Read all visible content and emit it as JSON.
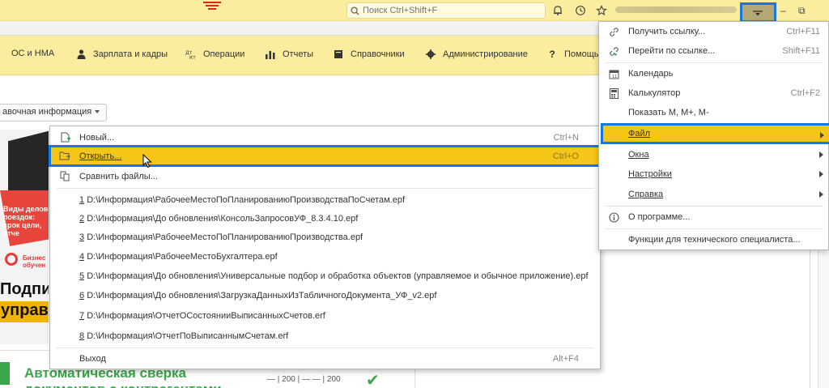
{
  "titlebar": {
    "search_placeholder": "Поиск Ctrl+Shift+F",
    "window_minimize": "–",
    "window_restore": "⧉"
  },
  "sections": {
    "items": [
      {
        "label": "ОС и НМА",
        "icon": "none"
      },
      {
        "label": "Зарплата и кадры",
        "icon": "person-icon"
      },
      {
        "label": "Операции",
        "icon": "debit-credit-icon"
      },
      {
        "label": "Отчеты",
        "icon": "bar-chart-icon"
      },
      {
        "label": "Справочники",
        "icon": "book-icon"
      },
      {
        "label": "Администрирование",
        "icon": "gear-icon"
      },
      {
        "label": "Помощь",
        "icon": "question-icon"
      }
    ]
  },
  "content": {
    "dropdown_label": "авочная информация"
  },
  "file_menu": {
    "new": {
      "label": "Новый...",
      "shortcut": "Ctrl+N"
    },
    "open": {
      "label": "Открыть...",
      "shortcut": "Ctrl+O"
    },
    "compare": {
      "label": "Сравнить файлы..."
    },
    "recent": [
      {
        "num": "1",
        "path": "D:\\Информация\\РабочееМестоПоПланированиюПроизводстваПоСчетам.epf"
      },
      {
        "num": "2",
        "path": "D:\\Информация\\До обновления\\КонсольЗапросовУФ_8.3.4.10.epf"
      },
      {
        "num": "3",
        "path": "D:\\Информация\\РабочееМестоПоПланированиюПроизводства.epf"
      },
      {
        "num": "4",
        "path": "D:\\Информация\\РабочееМестоБухгалтера.epf"
      },
      {
        "num": "5",
        "path": "D:\\Информация\\До обновления\\Универсальные подбор и обработка объектов (управляемое и обычное приложение).epf"
      },
      {
        "num": "6",
        "path": "D:\\Информация\\До обновления\\ЗагрузкаДанныхИзТабличногоДокумента_УФ_v2.epf"
      },
      {
        "num": "7",
        "path": "D:\\Информация\\ОтчетОСостоянииВыписанныхСчетов.erf"
      },
      {
        "num": "8",
        "path": "D:\\Информация\\ОтчетПоВыписаннымСчетам.erf"
      }
    ],
    "exit": {
      "label": "Выход",
      "shortcut": "Alt+F4"
    }
  },
  "main_menu": {
    "get_link": {
      "label": "Получить ссылку...",
      "shortcut": "Ctrl+F11"
    },
    "go_link": {
      "label": "Перейти по ссылке...",
      "shortcut": "Shift+F11"
    },
    "calendar": {
      "label": "Календарь"
    },
    "calculator": {
      "label": "Калькулятор",
      "shortcut": "Ctrl+F2"
    },
    "show_m": {
      "label": "Показать M, M+, M-"
    },
    "file": {
      "label": "Файл"
    },
    "windows": {
      "label": "Окна"
    },
    "settings": {
      "label": "Настройки"
    },
    "help": {
      "label": "Справка"
    },
    "about": {
      "label": "О программе..."
    },
    "tech": {
      "label": "Функции для технического специалиста..."
    }
  },
  "ad": {
    "red_text": "Виды делов поездок: срок цели, отче",
    "logo_text": "Бизнес обучен",
    "podpis": "Подпи",
    "uprav": "управл",
    "bottom_title": "Автоматическая сверка документов с контрагентами",
    "bottom_doc": "— | 200 | — — | 200"
  },
  "colors": {
    "accent_yellow": "#fbed9e",
    "highlight": "#f5c518",
    "focus_blue": "#1478e0",
    "brand_red": "#d22222",
    "ad_green": "#3aa84a"
  }
}
